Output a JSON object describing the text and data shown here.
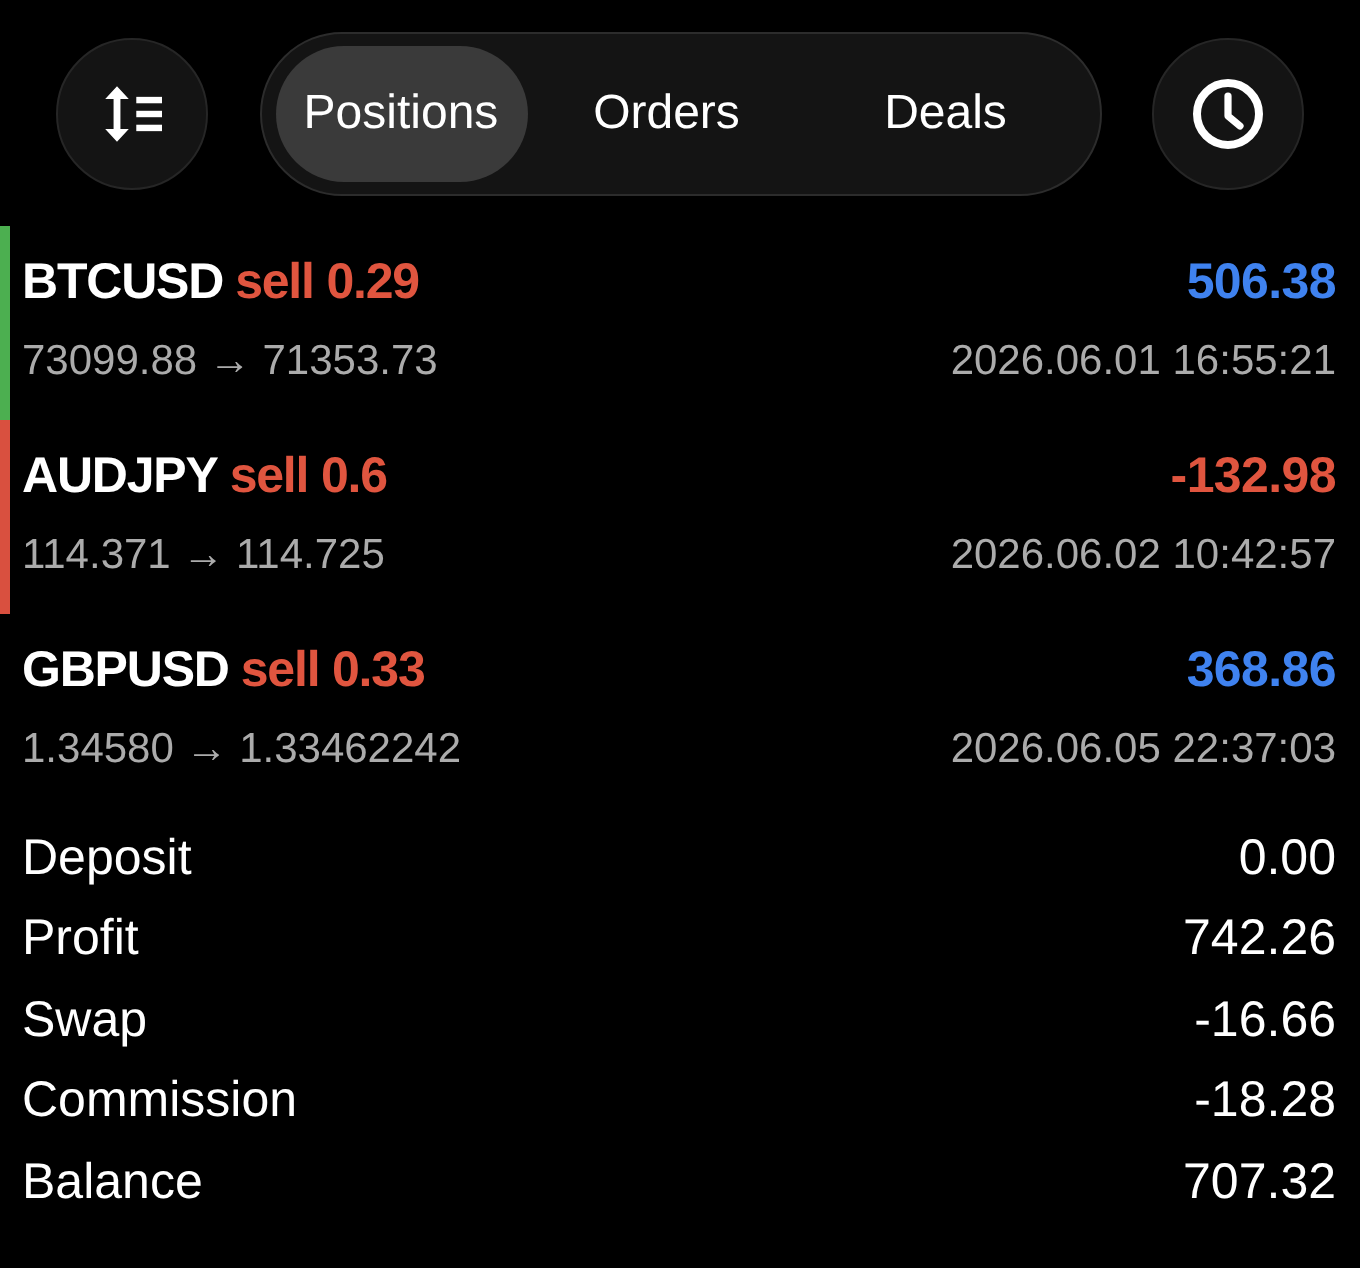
{
  "toolbar": {
    "tabs": [
      {
        "label": "Positions",
        "selected": true
      },
      {
        "label": "Orders",
        "selected": false
      },
      {
        "label": "Deals",
        "selected": false
      }
    ]
  },
  "positions": [
    {
      "symbol": "BTCUSD",
      "order": "sell 0.29",
      "profit": "506.38",
      "loss": false,
      "prices": "73099.88 → 71353.73",
      "time": "2026.06.01 16:55:21",
      "color": "#4caf50"
    },
    {
      "symbol": "AUDJPY",
      "order": "sell 0.6",
      "profit": "-132.98",
      "loss": true,
      "prices": "114.371 → 114.725",
      "time": "2026.06.02 10:42:57",
      "color": "#d9503f"
    },
    {
      "symbol": "GBPUSD",
      "order": "sell 0.33",
      "profit": "368.86",
      "loss": false,
      "prices": "1.34580 → 1.33462242",
      "time": "2026.06.05 22:37:03"
    }
  ],
  "summary": [
    {
      "label": "Deposit",
      "value": "0.00"
    },
    {
      "label": "Profit",
      "value": "742.26"
    },
    {
      "label": "Swap",
      "value": "-16.66"
    },
    {
      "label": "Commission",
      "value": "-18.28"
    },
    {
      "label": "Balance",
      "value": "707.32"
    }
  ]
}
